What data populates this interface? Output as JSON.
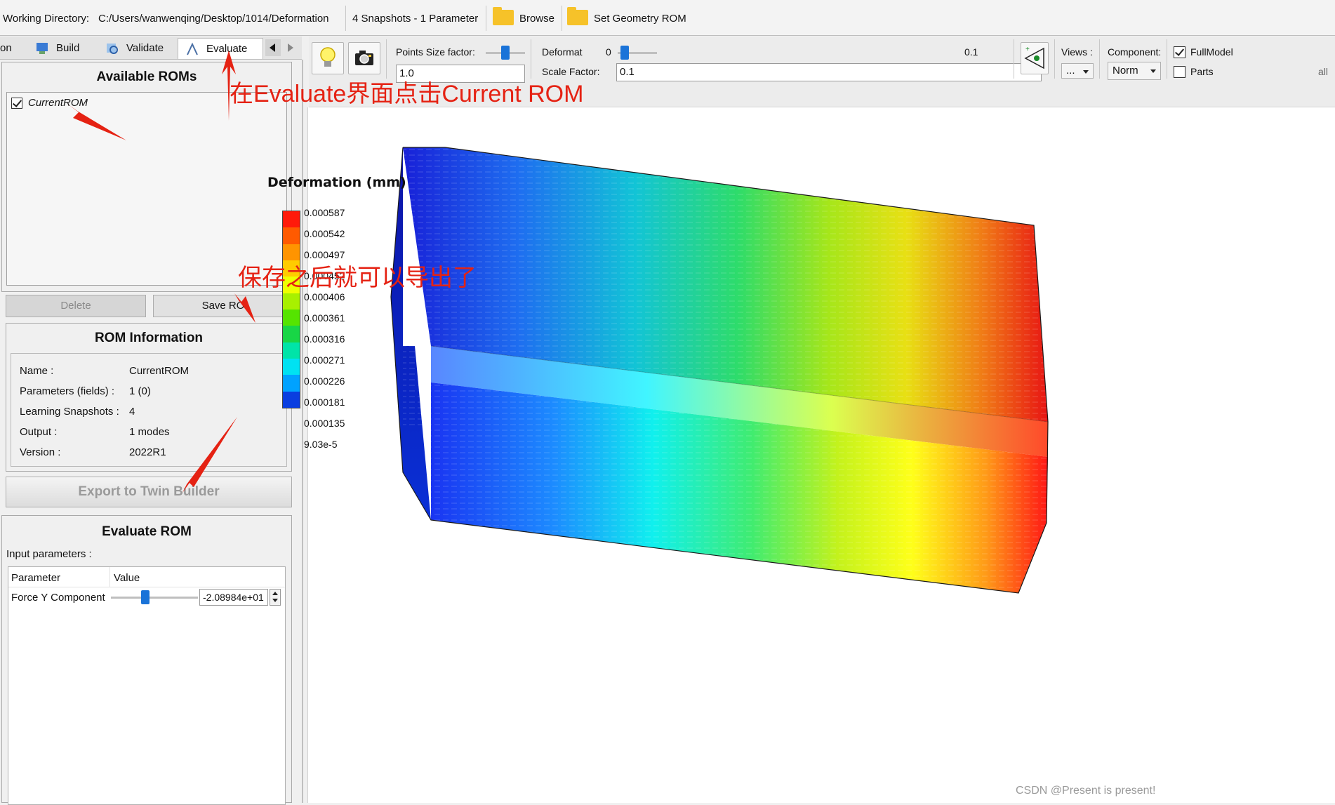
{
  "topbar": {
    "working_dir_label": "Working Directory:",
    "working_dir_value": "C:/Users/wanwenqing/Desktop/1014/Deformation",
    "snapshots_info": "4 Snapshots - 1 Parameter",
    "browse_label": "Browse",
    "set_geometry_label": "Set Geometry ROM"
  },
  "tabs": {
    "partial": "on",
    "build": "Build",
    "validate": "Validate",
    "evaluate": "Evaluate"
  },
  "available_roms": {
    "title": "Available ROMs",
    "items": [
      {
        "label": "CurrentROM",
        "checked": true
      }
    ],
    "delete_label": "Delete",
    "save_label": "Save RO"
  },
  "rom_info": {
    "title": "ROM Information",
    "rows": [
      {
        "key": "Name :",
        "value": "CurrentROM"
      },
      {
        "key": "Parameters (fields) :",
        "value": "1 (0)"
      },
      {
        "key": "Learning Snapshots :",
        "value": "4"
      },
      {
        "key": "Output :",
        "value": "1 modes"
      },
      {
        "key": "Version :",
        "value": "2022R1"
      }
    ],
    "export_label": "Export to Twin Builder"
  },
  "evaluate_rom": {
    "title": "Evaluate ROM",
    "input_params_label": "Input parameters :",
    "col_param": "Parameter",
    "col_value": "Value",
    "param_name": "Force Y Component",
    "param_value": "-2.08984e+01",
    "slider_fraction": 0.38
  },
  "toolbar": {
    "points_size_label": "Points Size factor:",
    "points_size_value": "1.0",
    "deformat_label": "Deformat",
    "deformat_min": "0",
    "deformat_max": "0.1",
    "scale_factor_label": "Scale Factor:",
    "scale_factor_value": "0.1",
    "views_label": "Views :",
    "views_value": "...",
    "component_label": "Component:",
    "component_value": "Norm",
    "fullmodel_label": "FullModel",
    "fullmodel_checked": true,
    "parts_label": "Parts",
    "parts_checked": false,
    "all_label": "all",
    "icons": [
      "bulb-icon",
      "camera-icon",
      "view-eye-icon"
    ]
  },
  "legend": {
    "title": "Deformation (mm)",
    "labels": [
      "0.000587",
      "0.000542",
      "0.000497",
      "0.000452",
      "0.000406",
      "0.000361",
      "0.000316",
      "0.000271",
      "0.000226",
      "0.000181",
      "0.000135",
      "9.03e-5"
    ],
    "colors": [
      "#ff1a0a",
      "#ff5a00",
      "#ff9400",
      "#ffcc00",
      "#eeff00",
      "#a8f000",
      "#55e400",
      "#18d646",
      "#00e4a8",
      "#00e2f2",
      "#00a2ff",
      "#0a3ee0"
    ]
  },
  "annotations": {
    "a1": "在Evaluate界面点击Current ROM",
    "a2": "保存之后就可以导出了"
  },
  "watermark": "CSDN @Present is present!"
}
